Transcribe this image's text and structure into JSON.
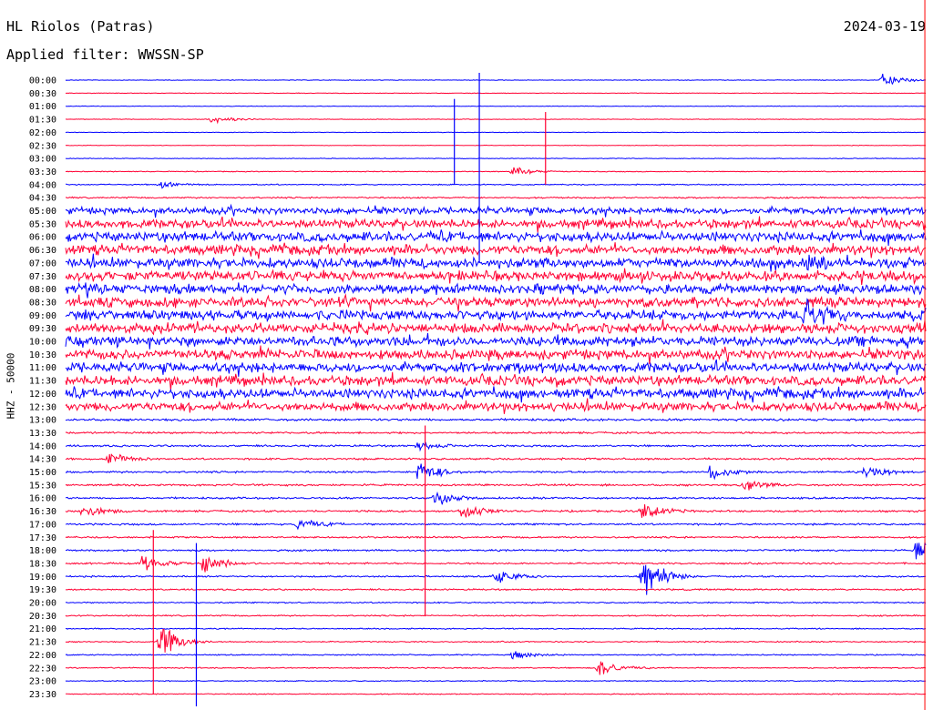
{
  "header": {
    "station": "HL Riolos (Patras)",
    "date": "2024-03-19",
    "filter": "Applied filter: WWSSN-SP"
  },
  "chart_data": {
    "type": "line",
    "title": "HL Riolos (Patras)",
    "ylabel": "HHZ - 50000",
    "xlabel": "",
    "colors": {
      "even_rows": "#0000ff",
      "odd_rows": "#ff0033",
      "marker": "#ff0000"
    },
    "rows": [
      "00:00",
      "00:30",
      "01:00",
      "01:30",
      "02:00",
      "02:30",
      "03:00",
      "03:30",
      "04:00",
      "04:30",
      "05:00",
      "05:30",
      "06:00",
      "06:30",
      "07:00",
      "07:30",
      "08:00",
      "08:30",
      "09:00",
      "09:30",
      "10:00",
      "10:30",
      "11:00",
      "11:30",
      "12:00",
      "12:30",
      "13:00",
      "13:30",
      "14:00",
      "14:30",
      "15:00",
      "15:30",
      "16:00",
      "16:30",
      "17:00",
      "17:30",
      "18:00",
      "18:30",
      "19:00",
      "19:30",
      "20:00",
      "20:30",
      "21:00",
      "21:30",
      "22:00",
      "22:30",
      "23:00",
      "23:30"
    ],
    "noise_level": [
      0.3,
      0.3,
      0.3,
      0.3,
      0.3,
      0.3,
      0.35,
      0.45,
      0.6,
      0.8,
      3.5,
      4.5,
      5,
      5,
      5,
      5,
      5,
      5,
      5,
      5,
      5,
      5,
      5,
      5,
      5,
      4.5,
      1.2,
      1.0,
      1.0,
      1.0,
      1.0,
      1.0,
      1.0,
      1.0,
      1.0,
      0.9,
      0.9,
      0.9,
      0.8,
      0.8,
      0.7,
      0.7,
      0.6,
      0.6,
      0.6,
      0.6,
      0.5,
      0.5
    ],
    "events": [
      {
        "row": 0,
        "t": 0.95,
        "amp": 10
      },
      {
        "row": 3,
        "t": 0.17,
        "amp": 6
      },
      {
        "row": 7,
        "t": 0.52,
        "amp": 6
      },
      {
        "row": 8,
        "t": 0.11,
        "amp": 4
      },
      {
        "row": 14,
        "t": 0.86,
        "amp": 8
      },
      {
        "row": 18,
        "t": 0.86,
        "amp": 18
      },
      {
        "row": 28,
        "t": 0.41,
        "amp": 6
      },
      {
        "row": 29,
        "t": 0.05,
        "amp": 8
      },
      {
        "row": 30,
        "t": 0.41,
        "amp": 14
      },
      {
        "row": 30,
        "t": 0.75,
        "amp": 10
      },
      {
        "row": 30,
        "t": 0.93,
        "amp": 10
      },
      {
        "row": 31,
        "t": 0.79,
        "amp": 8
      },
      {
        "row": 32,
        "t": 0.43,
        "amp": 10
      },
      {
        "row": 33,
        "t": 0.02,
        "amp": 10
      },
      {
        "row": 33,
        "t": 0.46,
        "amp": 12
      },
      {
        "row": 33,
        "t": 0.67,
        "amp": 14
      },
      {
        "row": 34,
        "t": 0.27,
        "amp": 8
      },
      {
        "row": 36,
        "t": 0.99,
        "amp": 14
      },
      {
        "row": 37,
        "t": 0.09,
        "amp": 10
      },
      {
        "row": 37,
        "t": 0.16,
        "amp": 14
      },
      {
        "row": 38,
        "t": 0.5,
        "amp": 10
      },
      {
        "row": 38,
        "t": 0.67,
        "amp": 32
      },
      {
        "row": 43,
        "t": 0.11,
        "amp": 24
      },
      {
        "row": 44,
        "t": 0.52,
        "amp": 6
      },
      {
        "row": 45,
        "t": 0.62,
        "amp": 12
      }
    ],
    "spikes": [
      {
        "t": 0.481,
        "row_from": 0,
        "row_to": 14
      },
      {
        "t": 0.452,
        "row_from": 2,
        "row_to": 8
      },
      {
        "t": 0.558,
        "row_from": 3,
        "row_to": 8
      },
      {
        "t": 0.418,
        "row_from": 27,
        "row_to": 41
      },
      {
        "t": 0.152,
        "row_from": 36,
        "row_to": 48
      },
      {
        "t": 0.102,
        "row_from": 35,
        "row_to": 47
      }
    ],
    "marker_t": 0.999
  }
}
